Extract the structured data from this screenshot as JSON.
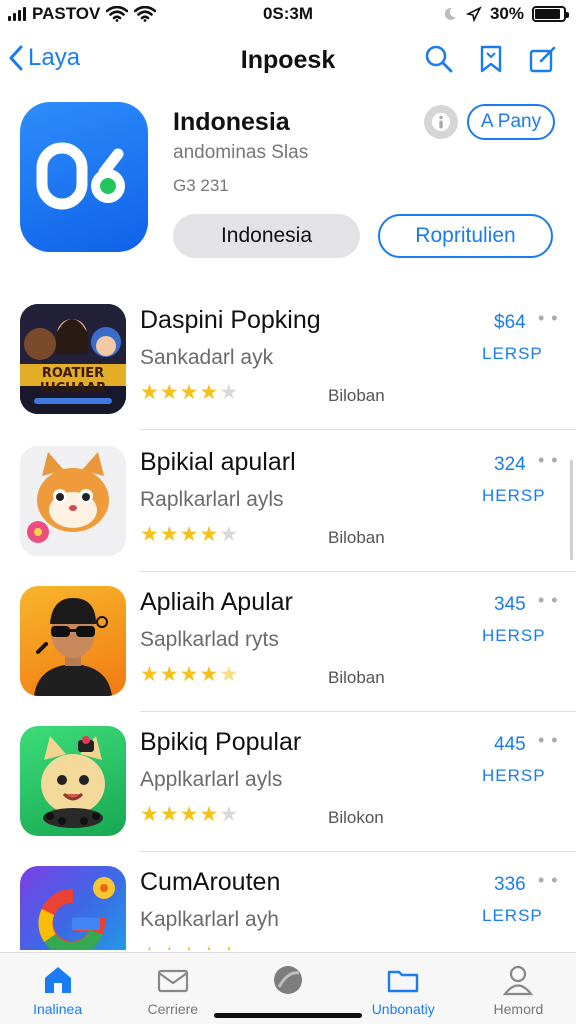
{
  "status_bar": {
    "carrier": "PASTOV",
    "time": "0S:3M",
    "battery": "30%",
    "battery_level": 0.9
  },
  "nav": {
    "back_label": "Laya",
    "title": "Inpoesk",
    "icons": [
      "search-icon",
      "bookmark-icon",
      "compose-icon"
    ]
  },
  "featured": {
    "name": "Indonesia",
    "subtitle": "andominas Slas",
    "meta": "G3 231",
    "pill_label": "A Pany",
    "primary_button": "Indonesia",
    "secondary_button": "Ropritulien",
    "accent": "#1a7cf2"
  },
  "apps": [
    {
      "name": "Daspini Popking",
      "subtitle": "Sankadarl ayk",
      "rating": 4,
      "source": "Biloban",
      "price": "$64",
      "cta": "LERSP",
      "thumb_text": "ROATIER IHCHAAR"
    },
    {
      "name": "Bpikial apularl",
      "subtitle": "Raplkarlarl ayls",
      "rating": 4,
      "source": "Biloban",
      "price": "324",
      "cta": "HERSP"
    },
    {
      "name": "Apliaih Apular",
      "subtitle": "Saplkarlad ryts",
      "rating": 4.5,
      "source": "Biloban",
      "price": "345",
      "cta": "HERSP"
    },
    {
      "name": "Bpikiq Popular",
      "subtitle": "Applkarlarl ayls",
      "rating": 4,
      "source": "Bilokon",
      "price": "445",
      "cta": "HERSP"
    },
    {
      "name": "CumArouten",
      "subtitle": "Kaplkarlarl ayh",
      "rating": 5,
      "source": "",
      "price": "336",
      "cta": "LERSP"
    }
  ],
  "tabs": [
    {
      "label": "Inalinea",
      "icon": "home-icon",
      "active": true
    },
    {
      "label": "Cerriere",
      "icon": "mail-icon",
      "active": false
    },
    {
      "label": "",
      "icon": "globe-icon",
      "active": false
    },
    {
      "label": "Unbonatiy",
      "icon": "folder-icon",
      "active": false
    },
    {
      "label": "Hemord",
      "icon": "person-icon",
      "active": false
    }
  ]
}
